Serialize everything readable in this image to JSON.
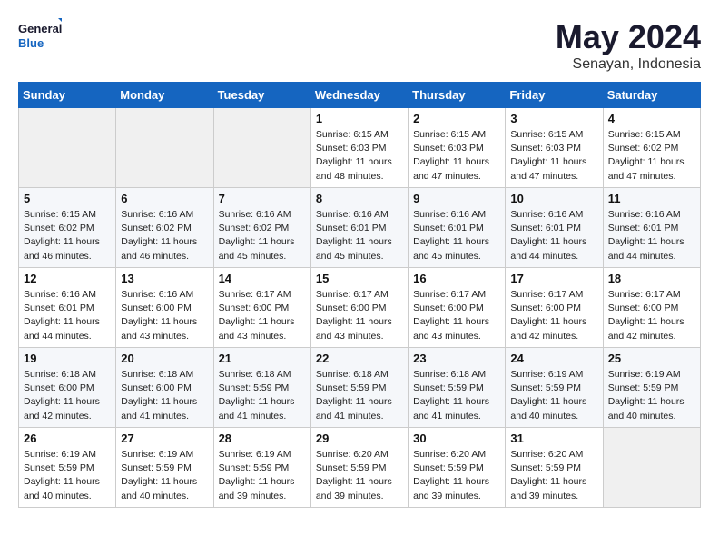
{
  "header": {
    "logo_general": "General",
    "logo_blue": "Blue",
    "month_year": "May 2024",
    "location": "Senayan, Indonesia"
  },
  "days_of_week": [
    "Sunday",
    "Monday",
    "Tuesday",
    "Wednesday",
    "Thursday",
    "Friday",
    "Saturday"
  ],
  "weeks": [
    [
      {
        "day": "",
        "info": ""
      },
      {
        "day": "",
        "info": ""
      },
      {
        "day": "",
        "info": ""
      },
      {
        "day": "1",
        "sunrise": "Sunrise: 6:15 AM",
        "sunset": "Sunset: 6:03 PM",
        "daylight": "Daylight: 11 hours and 48 minutes."
      },
      {
        "day": "2",
        "sunrise": "Sunrise: 6:15 AM",
        "sunset": "Sunset: 6:03 PM",
        "daylight": "Daylight: 11 hours and 47 minutes."
      },
      {
        "day": "3",
        "sunrise": "Sunrise: 6:15 AM",
        "sunset": "Sunset: 6:03 PM",
        "daylight": "Daylight: 11 hours and 47 minutes."
      },
      {
        "day": "4",
        "sunrise": "Sunrise: 6:15 AM",
        "sunset": "Sunset: 6:02 PM",
        "daylight": "Daylight: 11 hours and 47 minutes."
      }
    ],
    [
      {
        "day": "5",
        "sunrise": "Sunrise: 6:15 AM",
        "sunset": "Sunset: 6:02 PM",
        "daylight": "Daylight: 11 hours and 46 minutes."
      },
      {
        "day": "6",
        "sunrise": "Sunrise: 6:16 AM",
        "sunset": "Sunset: 6:02 PM",
        "daylight": "Daylight: 11 hours and 46 minutes."
      },
      {
        "day": "7",
        "sunrise": "Sunrise: 6:16 AM",
        "sunset": "Sunset: 6:02 PM",
        "daylight": "Daylight: 11 hours and 45 minutes."
      },
      {
        "day": "8",
        "sunrise": "Sunrise: 6:16 AM",
        "sunset": "Sunset: 6:01 PM",
        "daylight": "Daylight: 11 hours and 45 minutes."
      },
      {
        "day": "9",
        "sunrise": "Sunrise: 6:16 AM",
        "sunset": "Sunset: 6:01 PM",
        "daylight": "Daylight: 11 hours and 45 minutes."
      },
      {
        "day": "10",
        "sunrise": "Sunrise: 6:16 AM",
        "sunset": "Sunset: 6:01 PM",
        "daylight": "Daylight: 11 hours and 44 minutes."
      },
      {
        "day": "11",
        "sunrise": "Sunrise: 6:16 AM",
        "sunset": "Sunset: 6:01 PM",
        "daylight": "Daylight: 11 hours and 44 minutes."
      }
    ],
    [
      {
        "day": "12",
        "sunrise": "Sunrise: 6:16 AM",
        "sunset": "Sunset: 6:01 PM",
        "daylight": "Daylight: 11 hours and 44 minutes."
      },
      {
        "day": "13",
        "sunrise": "Sunrise: 6:16 AM",
        "sunset": "Sunset: 6:00 PM",
        "daylight": "Daylight: 11 hours and 43 minutes."
      },
      {
        "day": "14",
        "sunrise": "Sunrise: 6:17 AM",
        "sunset": "Sunset: 6:00 PM",
        "daylight": "Daylight: 11 hours and 43 minutes."
      },
      {
        "day": "15",
        "sunrise": "Sunrise: 6:17 AM",
        "sunset": "Sunset: 6:00 PM",
        "daylight": "Daylight: 11 hours and 43 minutes."
      },
      {
        "day": "16",
        "sunrise": "Sunrise: 6:17 AM",
        "sunset": "Sunset: 6:00 PM",
        "daylight": "Daylight: 11 hours and 43 minutes."
      },
      {
        "day": "17",
        "sunrise": "Sunrise: 6:17 AM",
        "sunset": "Sunset: 6:00 PM",
        "daylight": "Daylight: 11 hours and 42 minutes."
      },
      {
        "day": "18",
        "sunrise": "Sunrise: 6:17 AM",
        "sunset": "Sunset: 6:00 PM",
        "daylight": "Daylight: 11 hours and 42 minutes."
      }
    ],
    [
      {
        "day": "19",
        "sunrise": "Sunrise: 6:18 AM",
        "sunset": "Sunset: 6:00 PM",
        "daylight": "Daylight: 11 hours and 42 minutes."
      },
      {
        "day": "20",
        "sunrise": "Sunrise: 6:18 AM",
        "sunset": "Sunset: 6:00 PM",
        "daylight": "Daylight: 11 hours and 41 minutes."
      },
      {
        "day": "21",
        "sunrise": "Sunrise: 6:18 AM",
        "sunset": "Sunset: 5:59 PM",
        "daylight": "Daylight: 11 hours and 41 minutes."
      },
      {
        "day": "22",
        "sunrise": "Sunrise: 6:18 AM",
        "sunset": "Sunset: 5:59 PM",
        "daylight": "Daylight: 11 hours and 41 minutes."
      },
      {
        "day": "23",
        "sunrise": "Sunrise: 6:18 AM",
        "sunset": "Sunset: 5:59 PM",
        "daylight": "Daylight: 11 hours and 41 minutes."
      },
      {
        "day": "24",
        "sunrise": "Sunrise: 6:19 AM",
        "sunset": "Sunset: 5:59 PM",
        "daylight": "Daylight: 11 hours and 40 minutes."
      },
      {
        "day": "25",
        "sunrise": "Sunrise: 6:19 AM",
        "sunset": "Sunset: 5:59 PM",
        "daylight": "Daylight: 11 hours and 40 minutes."
      }
    ],
    [
      {
        "day": "26",
        "sunrise": "Sunrise: 6:19 AM",
        "sunset": "Sunset: 5:59 PM",
        "daylight": "Daylight: 11 hours and 40 minutes."
      },
      {
        "day": "27",
        "sunrise": "Sunrise: 6:19 AM",
        "sunset": "Sunset: 5:59 PM",
        "daylight": "Daylight: 11 hours and 40 minutes."
      },
      {
        "day": "28",
        "sunrise": "Sunrise: 6:19 AM",
        "sunset": "Sunset: 5:59 PM",
        "daylight": "Daylight: 11 hours and 39 minutes."
      },
      {
        "day": "29",
        "sunrise": "Sunrise: 6:20 AM",
        "sunset": "Sunset: 5:59 PM",
        "daylight": "Daylight: 11 hours and 39 minutes."
      },
      {
        "day": "30",
        "sunrise": "Sunrise: 6:20 AM",
        "sunset": "Sunset: 5:59 PM",
        "daylight": "Daylight: 11 hours and 39 minutes."
      },
      {
        "day": "31",
        "sunrise": "Sunrise: 6:20 AM",
        "sunset": "Sunset: 5:59 PM",
        "daylight": "Daylight: 11 hours and 39 minutes."
      },
      {
        "day": "",
        "info": ""
      }
    ]
  ]
}
